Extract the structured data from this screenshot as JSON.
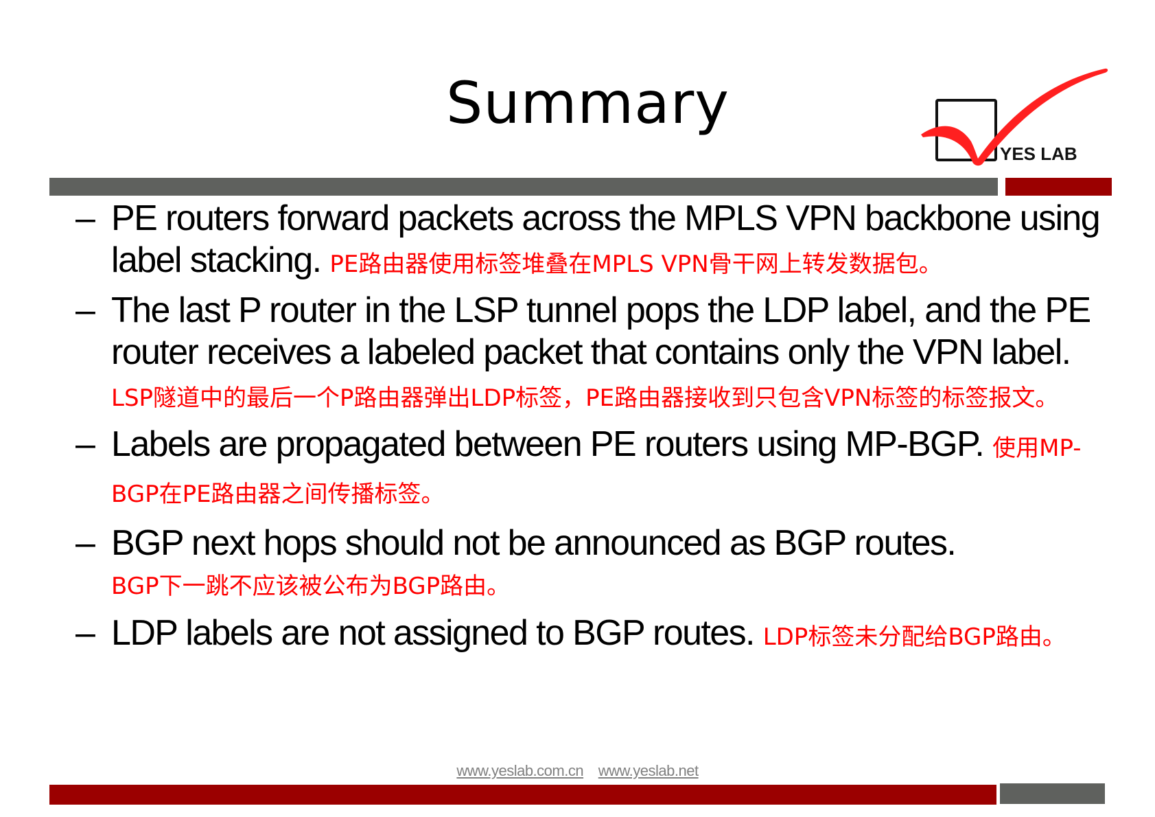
{
  "slide": {
    "title": "Summary",
    "logo": {
      "text": "YES LAB",
      "check_color": "#ff2020",
      "box_color": "#111111"
    },
    "colors": {
      "accent_red": "#9b0000",
      "bar_gray": "#5f615e",
      "translation_red": "#ff0000"
    },
    "bullets": [
      {
        "dash": "–",
        "en": "PE routers forward packets across the MPLS VPN backbone using label stacking.",
        "zh": "PE路由器使用标签堆叠在MPLS VPN骨干网上转发数据包。"
      },
      {
        "dash": "–",
        "en": "The last P router in the LSP tunnel pops the LDP  label, and the PE router receives a labeled packet  that contains only the VPN label.",
        "zh": "LSP隧道中的最后一个P路由器弹出LDP标签，PE路由器接收到只包含VPN标签的标签报文。"
      },
      {
        "dash": "–",
        "en": "Labels are propagated between PE routers using MP-BGP.",
        "zh": "使用MP-BGP在PE路由器之间传播标签。"
      },
      {
        "dash": "–",
        "en": "BGP next hops should not be announced as BGP  routes.",
        "zh": "BGP下一跳不应该被公布为BGP路由。"
      },
      {
        "dash": "–",
        "en": "LDP labels are not assigned to BGP routes.",
        "zh": "LDP标签未分配给BGP路由。"
      }
    ],
    "footer": {
      "links": [
        "www.yeslab.com.cn",
        "www.yeslab.net"
      ]
    }
  }
}
